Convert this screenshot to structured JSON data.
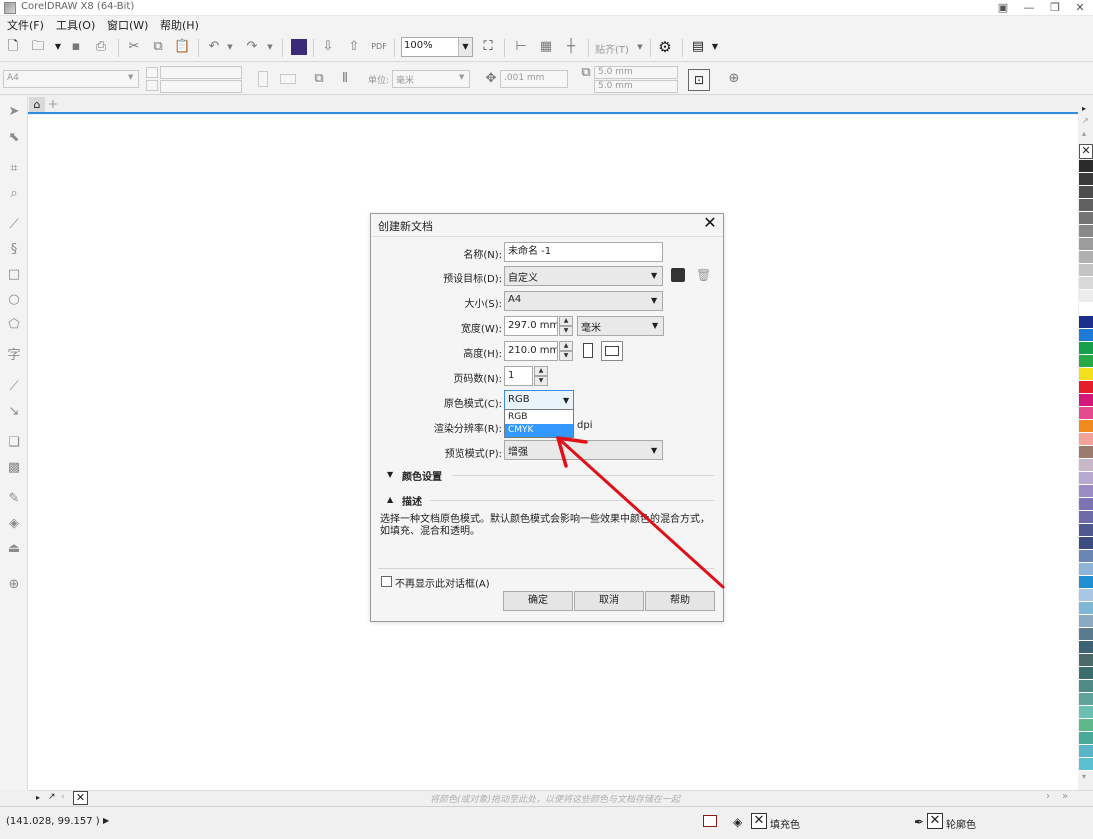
{
  "window": {
    "title": "CorelDRAW X8 (64-Bit)"
  },
  "menubar": {
    "items": [
      "文件(F)",
      "工具(O)",
      "窗口(W)",
      "帮助(H)"
    ]
  },
  "toolbar": {
    "zoom": "100%",
    "snap_label": "贴齐(T)"
  },
  "propbar": {
    "page_size": "A4",
    "unit_label": "单位:",
    "unit_value": "毫米",
    "nudge": ".001 mm",
    "dup_x": "5.0 mm",
    "dup_y": "5.0 mm"
  },
  "palette": {
    "colors": [
      "#2b2b2b",
      "#3a3a3a",
      "#4d4d4d",
      "#606060",
      "#747474",
      "#888888",
      "#9c9c9c",
      "#b0b0b0",
      "#c4c4c4",
      "#d8d8d8",
      "#ececec",
      "#ffffff",
      "#1c2f8a",
      "#1d7ad6",
      "#16a04b",
      "#29a945",
      "#f4e01a",
      "#e41e2a",
      "#d3187a",
      "#e64a8e",
      "#f08a1e",
      "#f4a39c",
      "#9a7b6d",
      "#c7b7c8",
      "#b6a8cf",
      "#9b8bc3",
      "#7c73b2",
      "#6c6ba8",
      "#4f588f",
      "#3d4c80",
      "#6a87b3",
      "#8fb4d8",
      "#1f8fd2",
      "#a9c7e4",
      "#7fb7d6",
      "#8aa8c0",
      "#5a7a8d",
      "#3f6374",
      "#4a6a6a",
      "#3d6e6e",
      "#4f8a86",
      "#5fa39b",
      "#6abfb2",
      "#5fb88a",
      "#4aaa9a",
      "#5ab5c8",
      "#5ac0d2"
    ]
  },
  "doc_bar": {
    "drag_hint": "将颜色(或对象)拖动至此处，以便将这些颜色与文档存储在一起"
  },
  "status": {
    "coords": "(141.028, 99.157 )",
    "fill_label": "填充色",
    "outline_label": "轮廓色"
  },
  "dialog": {
    "title": "创建新文档",
    "name_label": "名称(N):",
    "name_value": "未命名 -1",
    "preset_label": "预设目标(D):",
    "preset_value": "自定义",
    "size_label": "大小(S):",
    "size_value": "A4",
    "width_label": "宽度(W):",
    "width_value": "297.0 mm",
    "width_unit": "毫米",
    "height_label": "高度(H):",
    "height_value": "210.0 mm",
    "pages_label": "页码数(N):",
    "pages_value": "1",
    "colormode_label": "原色模式(C):",
    "colormode_value": "RGB",
    "colormode_options": [
      "RGB",
      "CMYK"
    ],
    "resolution_label": "渲染分辨率(R):",
    "resolution_unit": "dpi",
    "preview_label": "预览模式(P):",
    "preview_value": "增强",
    "color_settings": "颜色设置",
    "description_heading": "描述",
    "description_text": "选择一种文档原色模式。默认颜色模式会影响一些效果中颜色的混合方式，如填充、混合和透明。",
    "dont_show_again": "不再显示此对话框(A)",
    "ok_label": "确定",
    "cancel_label": "取消",
    "help_label": "帮助"
  }
}
